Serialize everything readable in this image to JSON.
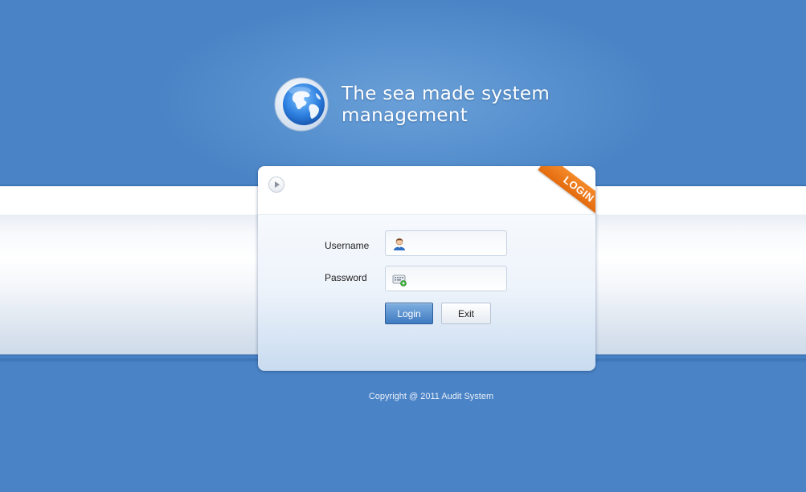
{
  "header": {
    "title_line1": "The sea made system",
    "title_line2": "management"
  },
  "icons": {
    "logo": "globe-icon",
    "play": "play-icon",
    "username": "user-icon",
    "password": "keyboard-icon"
  },
  "login_card": {
    "ribbon_label": "LOGIN",
    "username_label": "Username",
    "username_value": "",
    "password_label": "Password",
    "password_value": "",
    "login_button": "Login",
    "exit_button": "Exit"
  },
  "footer": {
    "copyright": "Copyright @ 2011 Audit System"
  },
  "colors": {
    "background": "#4b84c6",
    "ribbon": "#f07d1e",
    "login_button": "#4a86c8"
  }
}
